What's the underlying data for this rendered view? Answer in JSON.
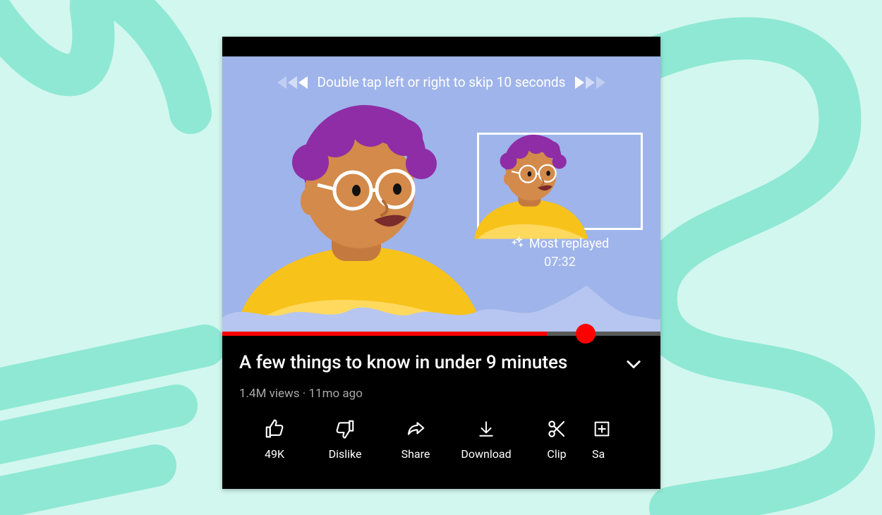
{
  "player": {
    "skip_hint": "Double tap left or right to skip 10 seconds",
    "most_replayed_label": "Most replayed",
    "most_replayed_time": "07:32",
    "progress_percent": 74,
    "knob_percent": 83
  },
  "video": {
    "title": "A few things to know in under 9 minutes",
    "views": "1.4M views",
    "age": "11mo ago",
    "separator": " · "
  },
  "actions": {
    "like_count": "49K",
    "dislike": "Dislike",
    "share": "Share",
    "download": "Download",
    "clip": "Clip",
    "save_partial": "Sa"
  },
  "colors": {
    "accent_red": "#ff0000",
    "bg_mint": "#d2f7ef",
    "video_bg": "#9fb4ea"
  }
}
